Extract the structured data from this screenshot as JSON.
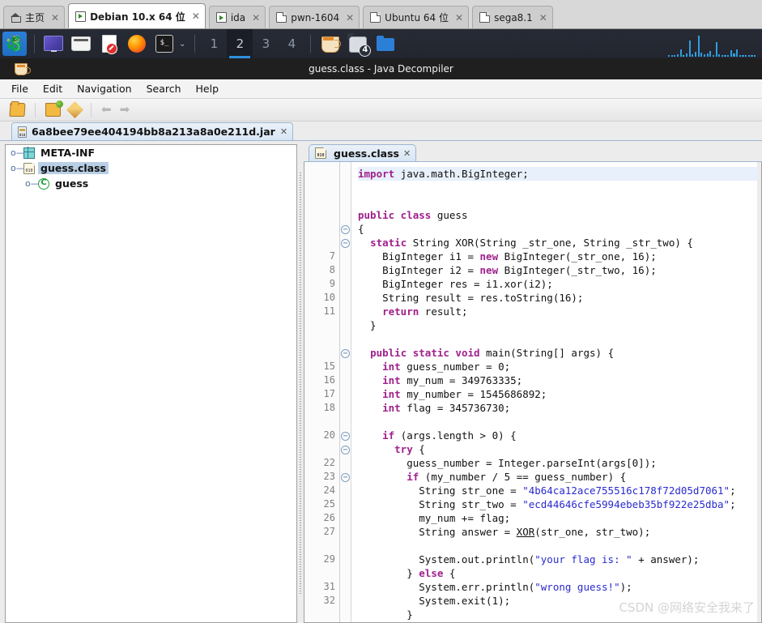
{
  "vm_tabs": [
    {
      "label": "主页",
      "icon": "home-icon",
      "active": false,
      "close": "✕"
    },
    {
      "label": "Debian 10.x 64 位",
      "icon": "run-icon",
      "active": true,
      "close": "✕"
    },
    {
      "label": "ida",
      "icon": "run-icon",
      "active": false,
      "close": "✕"
    },
    {
      "label": "pwn-1604",
      "icon": "doc-icon",
      "active": false,
      "close": "✕"
    },
    {
      "label": "Ubuntu 64 位",
      "icon": "doc-icon",
      "active": false,
      "close": "✕"
    },
    {
      "label": "sega8.1",
      "icon": "doc-icon",
      "active": false,
      "close": "✕"
    }
  ],
  "taskbar": {
    "kali_menu": "kali-dragon-icon",
    "launchers": [
      "display-icon",
      "files-icon",
      "document-icon",
      "firefox-icon",
      "terminal-icon"
    ],
    "terminal_caret": "⌄",
    "workspaces": [
      "1",
      "2",
      "3",
      "4"
    ],
    "active_workspace": "2",
    "window_buttons": [
      "java-cup-icon",
      "terminal-window-icon",
      "folder-icon"
    ],
    "terminal_badge_count": "4",
    "accent_color": "#2e8fe0",
    "graph_bars": [
      2,
      1,
      1,
      3,
      9,
      2,
      4,
      20,
      3,
      6,
      26,
      5,
      3,
      4,
      7,
      2,
      18,
      3,
      2,
      1,
      2,
      8,
      4,
      9,
      2,
      1,
      1,
      2,
      2,
      1
    ]
  },
  "app": {
    "title": "guess.class - Java Decompiler",
    "icon": "java-cup-icon",
    "menu": [
      "File",
      "Edit",
      "Navigation",
      "Search",
      "Help"
    ],
    "toolbar": [
      {
        "name": "open-file-icon"
      },
      {
        "name": "open-recent-icon"
      },
      {
        "name": "edit-pen-icon"
      },
      {
        "name": "back-arrow-icon",
        "glyph": "⬅"
      },
      {
        "name": "forward-arrow-icon",
        "glyph": "➡"
      }
    ],
    "jar_tab": {
      "label": "6a8bee79ee404194bb8a213a8a0e211d.jar",
      "close": "✕",
      "icon": "jar-icon"
    }
  },
  "tree": {
    "nodes": [
      {
        "label": "META-INF",
        "icon": "package-icon",
        "handle": "o—",
        "indent": 0,
        "selected": false
      },
      {
        "label": "guess.class",
        "icon": "class-file-icon",
        "handle": "o—",
        "indent": 0,
        "selected": true
      },
      {
        "label": "guess",
        "icon": "class-icon",
        "handle": "o—",
        "indent": 1,
        "selected": false,
        "glyph": "C"
      }
    ]
  },
  "editor": {
    "tab": {
      "label": "guess.class",
      "close": "✕",
      "icon": "class-file-icon"
    },
    "lines": [
      {
        "num": "",
        "fold": "",
        "html": "<span class=\"k\">import</span> java.math.BigInteger;",
        "highlight": true
      },
      {
        "num": "",
        "fold": "",
        "html": ""
      },
      {
        "num": "",
        "fold": "",
        "html": ""
      },
      {
        "num": "",
        "fold": "",
        "html": "<span class=\"k\">public class</span> guess"
      },
      {
        "num": "",
        "fold": "−",
        "html": "{"
      },
      {
        "num": "",
        "fold": "−",
        "html": "  <span class=\"k\">static</span> String XOR(String _str_one, String _str_two) {"
      },
      {
        "num": "7",
        "fold": "",
        "html": "    BigInteger i1 = <span class=\"k\">new</span> BigInteger(_str_one, 16);"
      },
      {
        "num": "8",
        "fold": "",
        "html": "    BigInteger i2 = <span class=\"k\">new</span> BigInteger(_str_two, 16);"
      },
      {
        "num": "9",
        "fold": "",
        "html": "    BigInteger res = i1.xor(i2);"
      },
      {
        "num": "10",
        "fold": "",
        "html": "    String result = res.toString(16);"
      },
      {
        "num": "11",
        "fold": "",
        "html": "    <span class=\"k\">return</span> result;"
      },
      {
        "num": "",
        "fold": "",
        "html": "  }"
      },
      {
        "num": "",
        "fold": "",
        "html": ""
      },
      {
        "num": "",
        "fold": "−",
        "html": "  <span class=\"k\">public static void</span> main(String[] args) {"
      },
      {
        "num": "15",
        "fold": "",
        "html": "    <span class=\"k\">int</span> guess_number = 0;"
      },
      {
        "num": "16",
        "fold": "",
        "html": "    <span class=\"k\">int</span> my_num = 349763335;"
      },
      {
        "num": "17",
        "fold": "",
        "html": "    <span class=\"k\">int</span> my_number = 1545686892;"
      },
      {
        "num": "18",
        "fold": "",
        "html": "    <span class=\"k\">int</span> flag = 345736730;"
      },
      {
        "num": "",
        "fold": "",
        "html": ""
      },
      {
        "num": "20",
        "fold": "−",
        "html": "    <span class=\"k\">if</span> (args.length &gt; 0) {"
      },
      {
        "num": "",
        "fold": "−",
        "html": "      <span class=\"k\">try</span> {"
      },
      {
        "num": "22",
        "fold": "",
        "html": "        guess_number = Integer.parseInt(args[0]);"
      },
      {
        "num": "23",
        "fold": "−",
        "html": "        <span class=\"k\">if</span> (my_number / 5 == guess_number) {"
      },
      {
        "num": "24",
        "fold": "",
        "html": "          String str_one = <span class=\"s\">\"4b64ca12ace755516c178f72d05d7061\"</span>;"
      },
      {
        "num": "25",
        "fold": "",
        "html": "          String str_two = <span class=\"s\">\"ecd44646cfe5994ebeb35bf922e25dba\"</span>;"
      },
      {
        "num": "26",
        "fold": "",
        "html": "          my_num += flag;"
      },
      {
        "num": "27",
        "fold": "",
        "html": "          String answer = <span class=\"u\">XOR</span>(str_one, str_two);"
      },
      {
        "num": "",
        "fold": "",
        "html": ""
      },
      {
        "num": "29",
        "fold": "",
        "html": "          System.out.println(<span class=\"s\">\"your flag is: \"</span> + answer);"
      },
      {
        "num": "",
        "fold": "",
        "html": "        } <span class=\"k\">else</span> {"
      },
      {
        "num": "31",
        "fold": "",
        "html": "          System.err.println(<span class=\"s\">\"wrong guess!\"</span>);"
      },
      {
        "num": "32",
        "fold": "",
        "html": "          System.exit(1);"
      },
      {
        "num": "",
        "fold": "",
        "html": "        }"
      }
    ]
  },
  "watermark": "CSDN @网络安全我来了"
}
